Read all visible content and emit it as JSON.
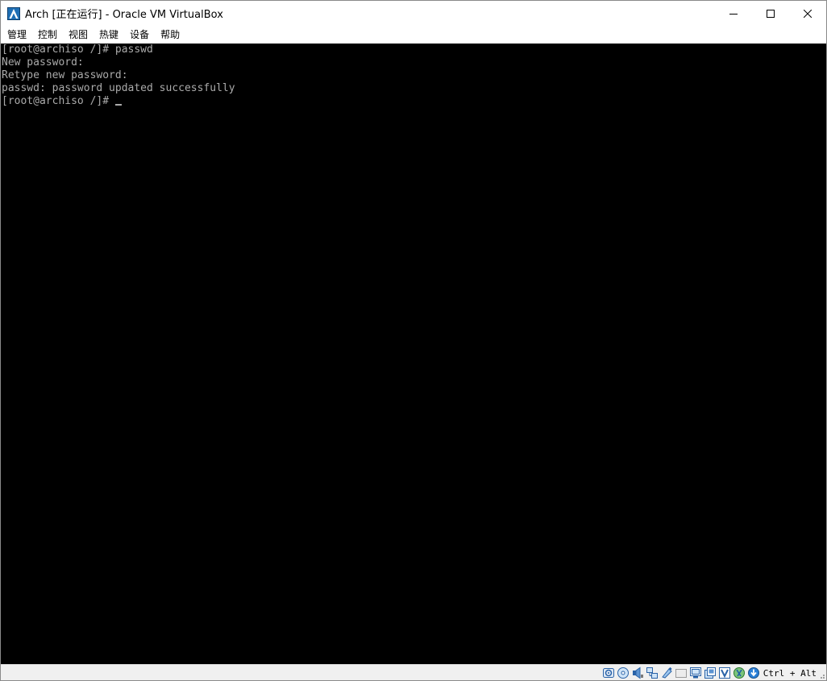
{
  "window": {
    "title": "Arch [正在运行] - Oracle VM VirtualBox",
    "app_icon": "virtualbox-arch-icon",
    "controls": {
      "minimize": "minimize-icon",
      "maximize": "maximize-icon",
      "close": "close-icon"
    }
  },
  "menu": {
    "items": [
      {
        "label": "管理"
      },
      {
        "label": "控制"
      },
      {
        "label": "视图"
      },
      {
        "label": "热键"
      },
      {
        "label": "设备"
      },
      {
        "label": "帮助"
      }
    ]
  },
  "terminal": {
    "lines": [
      "[root@archiso /]# passwd",
      "New password:",
      "Retype new password:",
      "passwd: password updated successfully",
      "[root@archiso /]# "
    ],
    "foreground": "#aaaaaa",
    "background": "#000000"
  },
  "statusbar": {
    "icons": [
      "hard-disk-icon",
      "optical-drive-icon",
      "audio-icon",
      "network-icon",
      "usb-icon",
      "shared-folders-icon",
      "display-icon",
      "video-capture-icon",
      "virtualization-icon",
      "mouse-integration-icon",
      "keyboard-capture-icon"
    ],
    "host_key": "Ctrl + Alt"
  }
}
